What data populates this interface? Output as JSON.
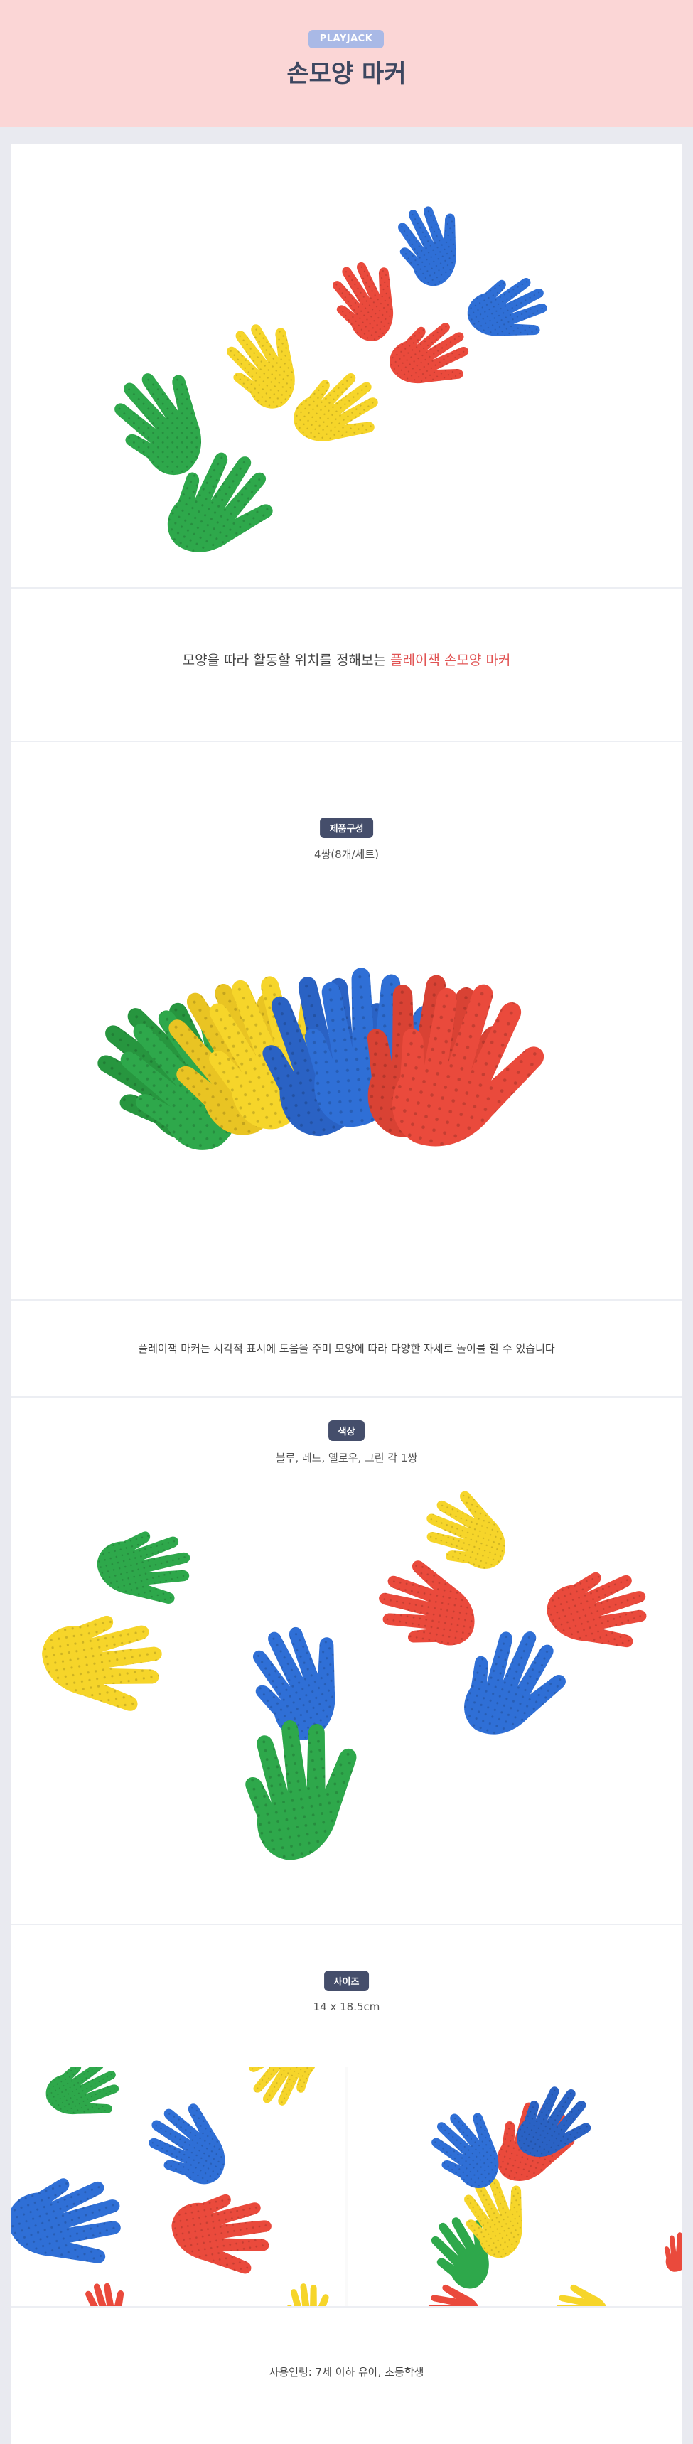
{
  "header": {
    "brand": "PLAYJACK",
    "title": "손모양 마커",
    "bg_color": "#fbd6d6"
  },
  "intro": {
    "tagline_prefix": "모양을 따라 활동할 위치를 정해보는 ",
    "tagline_highlight": "플레이잭 손모양 마커",
    "highlight_color": "#e15454"
  },
  "composition": {
    "badge": "제품구성",
    "value": "4쌍(8개/세트)",
    "caption": "플레이잭 마커는 시각적 표시에 도움을 주며 모양에 따라 다양한 자세로 놀이를 할 수 있습니다"
  },
  "colors_section": {
    "badge": "색상",
    "value": "블루, 레드, 옐로우, 그린 각 1쌍",
    "palette": {
      "blue": "#2f6fd6",
      "red": "#ea4a3c",
      "yellow": "#f6d52a",
      "green": "#2ea84b"
    }
  },
  "size_section": {
    "badge": "사이즈",
    "value": "14 x 18.5cm"
  },
  "footer": {
    "age": "사용연령: 7세 이하 유아, 초등학생"
  }
}
